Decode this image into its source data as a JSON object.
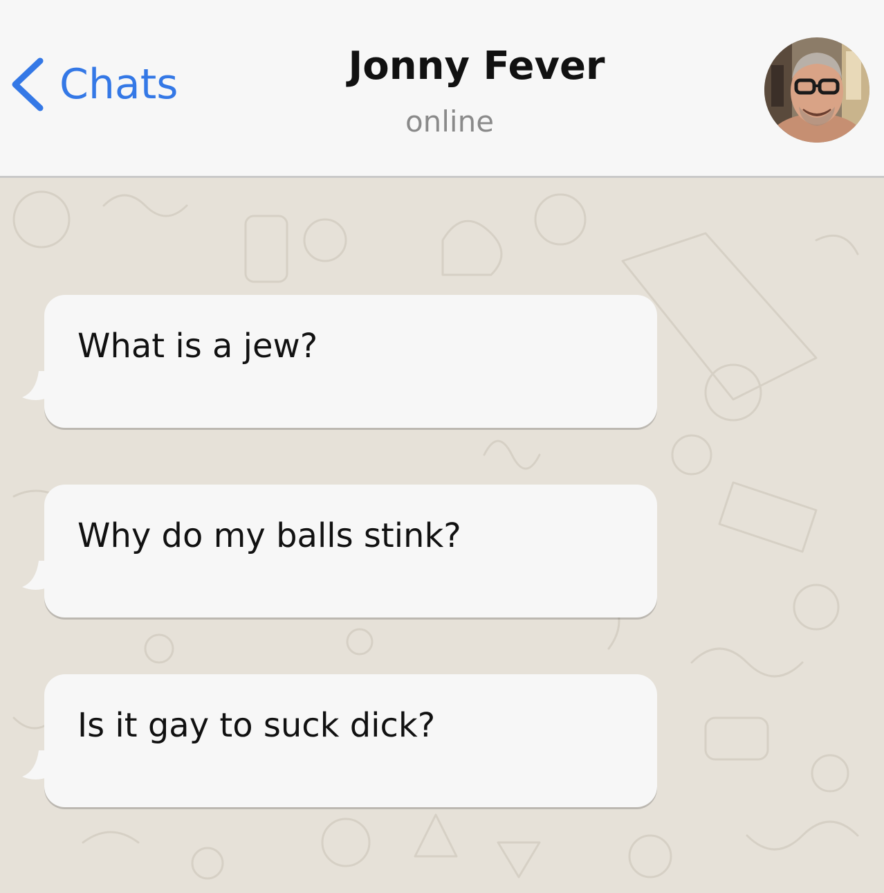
{
  "header": {
    "back_label": "Chats",
    "title": "Jonny Fever",
    "status": "online",
    "accent_color": "#3478e6"
  },
  "messages": [
    {
      "text": "What is a jew?",
      "direction": "incoming"
    },
    {
      "text": "Why do my balls stink?",
      "direction": "incoming"
    },
    {
      "text": "Is it gay to suck dick?",
      "direction": "incoming"
    }
  ],
  "icons": {
    "back": "chevron-left-icon",
    "avatar": "contact-avatar"
  }
}
